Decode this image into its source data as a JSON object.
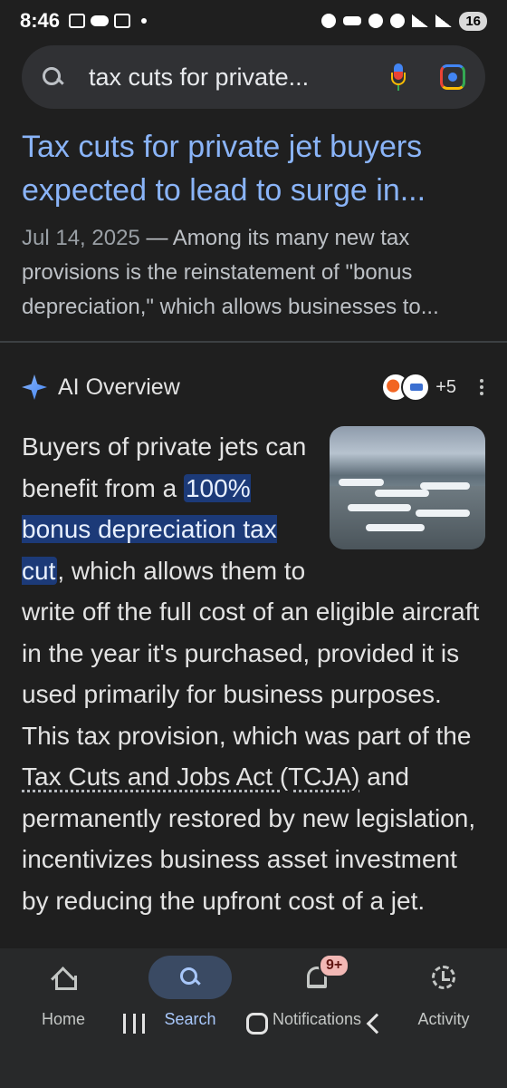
{
  "status_bar": {
    "time": "8:46",
    "battery": "16"
  },
  "search": {
    "query": "tax cuts for private..."
  },
  "result": {
    "title": "Tax cuts for private jet buyers expected to lead to surge in...",
    "date": "Jul 14, 2025",
    "snippet": " — Among its many new tax provisions is the reinstatement of \"bonus depreciation,\" which allows businesses to..."
  },
  "ai_overview": {
    "title": "AI Overview",
    "sources_more": "+5",
    "body": {
      "intro": "Buyers of private jets can benefit from a ",
      "highlight": "100% bonus deprecia­tion tax cut",
      "after_highlight": ", which allows them to write off the full cost of an eligible aircraft in the year it's purchased, provided it is used primarily for business purposes. This tax provision, which was part of the ",
      "link": "Tax Cuts and Jobs Act (TCJA)",
      "tail": " and permanently restored by new legislation, incentivizes business asset investment by reducing the upfront cost of a jet."
    }
  },
  "bottom_nav": {
    "items": [
      {
        "label": "Home",
        "icon": "home-icon"
      },
      {
        "label": "Search",
        "icon": "search-icon"
      },
      {
        "label": "Notifications",
        "icon": "bell-icon",
        "badge": "9+"
      },
      {
        "label": "Activity",
        "icon": "activity-icon"
      }
    ]
  },
  "colors": {
    "background": "#1f1f1f",
    "link": "#8ab4f8",
    "highlight": "#1c3a78",
    "nav_active": "#a8c7fa"
  }
}
